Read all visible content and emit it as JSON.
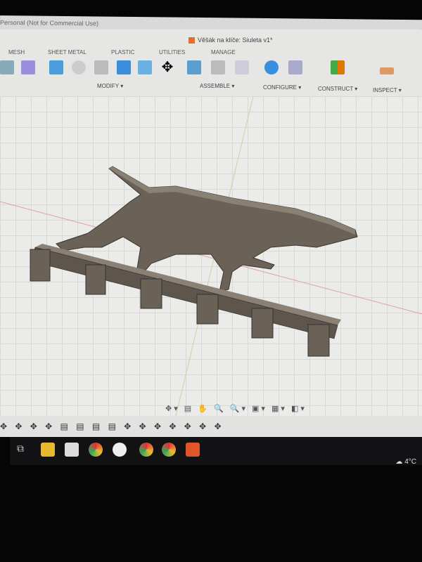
{
  "window": {
    "title": "Personal (Not for Commercial Use)",
    "document": "Věšák na klíče: Siuleta v1*"
  },
  "toolbar": {
    "tabs": [
      "MESH",
      "SHEET METAL",
      "PLASTIC",
      "UTILITIES",
      "MANAGE"
    ],
    "groups": [
      "MODIFY ▾",
      "ASSEMBLE ▾",
      "CONFIGURE ▾",
      "CONSTRUCT ▾",
      "INSPECT ▾"
    ]
  },
  "navbar": {
    "icons": "✥▾ ▤ ✋ 🔍 🔍▾ ▣▾ ▦▾ ◧▾"
  },
  "timeline": {
    "icons": "✥ ✥ ✥ ✥ ▤ ▤ ▤ ▤ ✥ ✥ ✥ ✥ ✥ ✥ ✥"
  },
  "taskbar": {
    "apps": [
      "task-view",
      "file-explorer",
      "store",
      "chrome",
      "app",
      "chrome",
      "chrome",
      "fusion-360"
    ],
    "weather": "4°C"
  },
  "colors": {
    "model": "#6b6257",
    "accent": "#e0562a"
  }
}
